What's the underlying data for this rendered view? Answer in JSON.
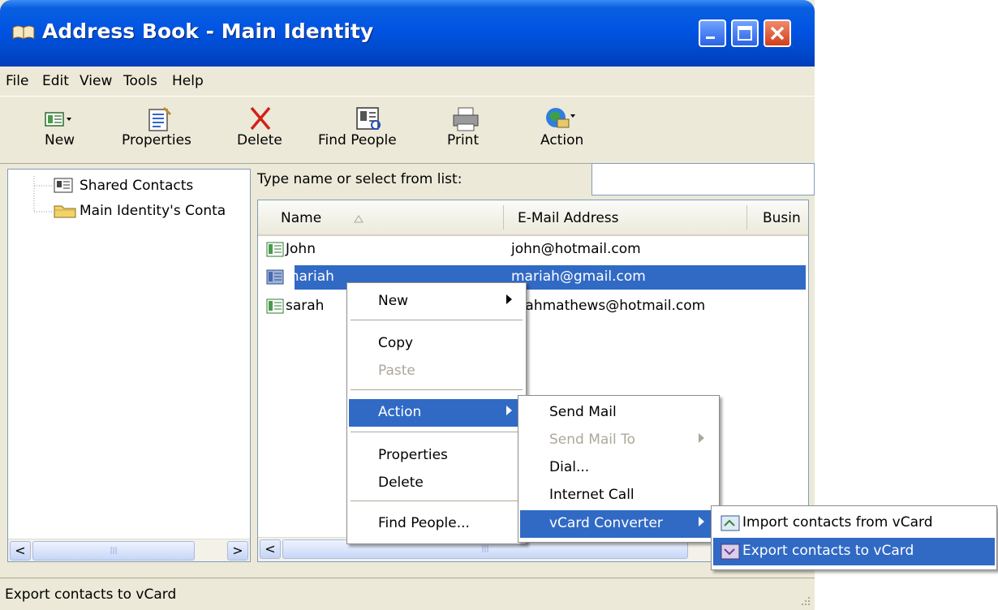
{
  "window": {
    "title": "Address Book - Main Identity"
  },
  "menubar": [
    "File",
    "Edit",
    "View",
    "Tools",
    "Help"
  ],
  "toolbar": [
    "New",
    "Properties",
    "Delete",
    "Find People",
    "Print",
    "Action"
  ],
  "tree": {
    "items": [
      "Shared Contacts",
      "Main Identity's Conta"
    ]
  },
  "search": {
    "label": "Type name or select from list:",
    "value": ""
  },
  "list": {
    "columns": [
      "Name",
      "E-Mail Address",
      "Busin"
    ],
    "rows": [
      {
        "name": "John",
        "email": "john@hotmail.com",
        "selected": false
      },
      {
        "name": "mariah",
        "email": "mariah@gmail.com",
        "selected": true
      },
      {
        "name": "sarah",
        "email": "arahmathews@hotmail.com",
        "selected": false
      }
    ]
  },
  "context_menu": {
    "items": [
      "New",
      "Copy",
      "Paste",
      "Action",
      "Properties",
      "Delete",
      "Find People..."
    ]
  },
  "action_submenu": {
    "items": [
      "Send Mail",
      "Send Mail To",
      "Dial...",
      "Internet Call",
      "vCard Converter"
    ]
  },
  "vcard_submenu": {
    "items": [
      "Import contacts from vCard",
      "Export contacts to vCard"
    ]
  },
  "status": {
    "text": "Export contacts to vCard"
  },
  "colors": {
    "selection": "#316ac5",
    "titlebar": "#0054e3",
    "chrome": "#ece9d8"
  }
}
